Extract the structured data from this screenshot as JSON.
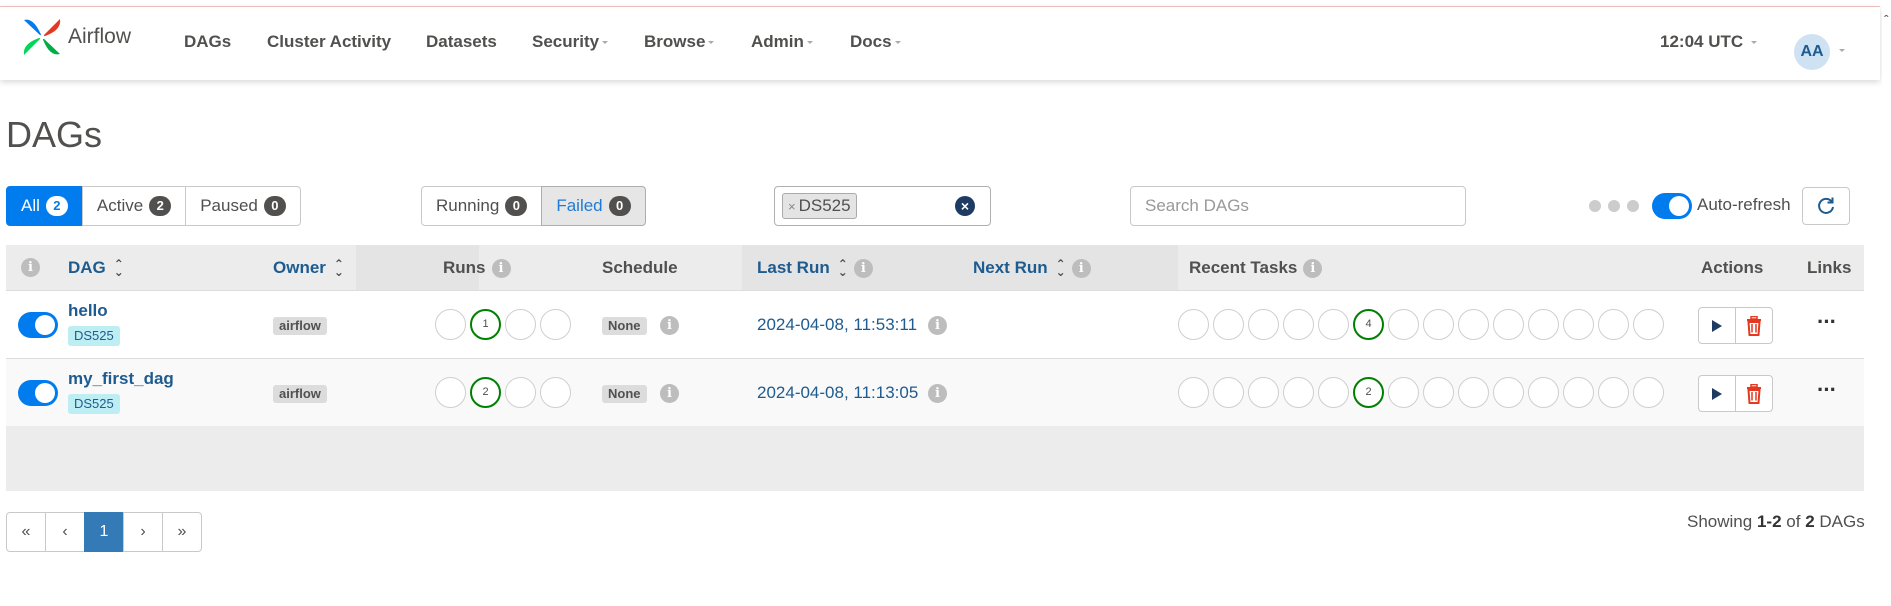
{
  "brand": {
    "name": "Airflow",
    "colors": {
      "red": "#e43921",
      "blue": "#017cee",
      "green": "#04d659",
      "teal": "#00ad46"
    }
  },
  "nav": {
    "items": [
      {
        "label": "DAGs",
        "dropdown": false
      },
      {
        "label": "Cluster Activity",
        "dropdown": false
      },
      {
        "label": "Datasets",
        "dropdown": false
      },
      {
        "label": "Security",
        "dropdown": true
      },
      {
        "label": "Browse",
        "dropdown": true
      },
      {
        "label": "Admin",
        "dropdown": true
      },
      {
        "label": "Docs",
        "dropdown": true
      }
    ],
    "time": "12:04 UTC",
    "user_initials": "AA"
  },
  "page": {
    "title": "DAGs"
  },
  "filters": {
    "status_tabs": [
      {
        "label": "All",
        "count": "2",
        "active": true
      },
      {
        "label": "Active",
        "count": "2",
        "active": false
      },
      {
        "label": "Paused",
        "count": "0",
        "active": false
      }
    ],
    "run_state_tabs": [
      {
        "label": "Running",
        "count": "0",
        "selected": false
      },
      {
        "label": "Failed",
        "count": "0",
        "selected": true
      }
    ],
    "tag_filter": {
      "remove_symbol": "×",
      "tag": "DS525"
    },
    "search": {
      "placeholder": "Search DAGs",
      "value": ""
    },
    "auto_refresh": {
      "label": "Auto-refresh",
      "enabled": true
    }
  },
  "table": {
    "headers": {
      "dag": "DAG",
      "owner": "Owner",
      "runs": "Runs",
      "schedule": "Schedule",
      "last_run": "Last Run",
      "next_run": "Next Run",
      "recent_tasks": "Recent Tasks",
      "actions": "Actions",
      "links": "Links"
    },
    "rows": [
      {
        "name": "hello",
        "tag": "DS525",
        "owner": "airflow",
        "enabled": true,
        "runs": [
          "",
          "1",
          "",
          ""
        ],
        "runs_highlight": 1,
        "schedule": "None",
        "last_run": "2024-04-08, 11:53:11",
        "next_run": "",
        "recent_tasks": [
          "",
          "",
          "",
          "",
          "",
          "4",
          "",
          "",
          "",
          "",
          "",
          "",
          "",
          ""
        ],
        "recent_highlight": 5
      },
      {
        "name": "my_first_dag",
        "tag": "DS525",
        "owner": "airflow",
        "enabled": true,
        "runs": [
          "",
          "2",
          "",
          ""
        ],
        "runs_highlight": 1,
        "schedule": "None",
        "last_run": "2024-04-08, 11:13:05",
        "next_run": "",
        "recent_tasks": [
          "",
          "",
          "",
          "",
          "",
          "2",
          "",
          "",
          "",
          "",
          "",
          "",
          "",
          ""
        ],
        "recent_highlight": 5
      }
    ]
  },
  "pagination": {
    "first": "«",
    "prev": "‹",
    "current": "1",
    "next": "›",
    "last": "»",
    "showing_prefix": "Showing",
    "range": "1-2",
    "of": "of",
    "total": "2",
    "suffix": "DAGs"
  },
  "icons": {
    "info": "info-icon",
    "sort": "sort-icon",
    "play": "play-icon",
    "delete": "trash-icon",
    "more": "more-icon",
    "refresh": "refresh-icon"
  }
}
